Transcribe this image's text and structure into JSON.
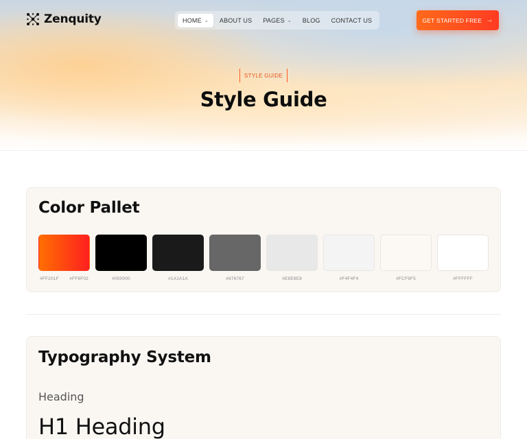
{
  "brand": {
    "name": "Zenquity",
    "logo_icon": "network-logo-icon"
  },
  "nav": {
    "items": [
      {
        "label": "HOME",
        "has_dropdown": true,
        "active": true
      },
      {
        "label": "ABOUT US",
        "has_dropdown": false,
        "active": false
      },
      {
        "label": "PAGES",
        "has_dropdown": true,
        "active": false
      },
      {
        "label": "BLOG",
        "has_dropdown": false,
        "active": false
      },
      {
        "label": "CONTACT US",
        "has_dropdown": false,
        "active": false
      }
    ],
    "dropdown_icon": "chevron-down-icon"
  },
  "cta": {
    "label": "GET STARTED FREE",
    "icon": "arrow-right-icon",
    "color_start": "#FF6A1A",
    "color_end": "#FF3B22"
  },
  "hero": {
    "tag": "STYLE GUIDE",
    "title": "Style Guide"
  },
  "palette": {
    "title": "Color Pallet",
    "swatches": [
      {
        "colors": [
          "#FF201F",
          "#FF6F02"
        ],
        "codes": [
          "#FF201F",
          "#FF6F02"
        ],
        "gradient": true
      },
      {
        "colors": [
          "#000000"
        ],
        "codes": [
          "#000000"
        ]
      },
      {
        "colors": [
          "#1A1A1A"
        ],
        "codes": [
          "#1A1A1A"
        ]
      },
      {
        "colors": [
          "#676767"
        ],
        "codes": [
          "#676767"
        ]
      },
      {
        "colors": [
          "#E8E8E8"
        ],
        "codes": [
          "#E8E8E8"
        ]
      },
      {
        "colors": [
          "#F4F4F4"
        ],
        "codes": [
          "#F4F4F4"
        ]
      },
      {
        "colors": [
          "#FCF9F5"
        ],
        "codes": [
          "#FCF9F5"
        ]
      },
      {
        "colors": [
          "#FFFFFF"
        ],
        "codes": [
          "#FFFFFF"
        ]
      }
    ]
  },
  "typography": {
    "title": "Typography System",
    "label": "Heading",
    "h1_sample": "H1 Heading"
  },
  "accent_color": "#FF5A1F"
}
